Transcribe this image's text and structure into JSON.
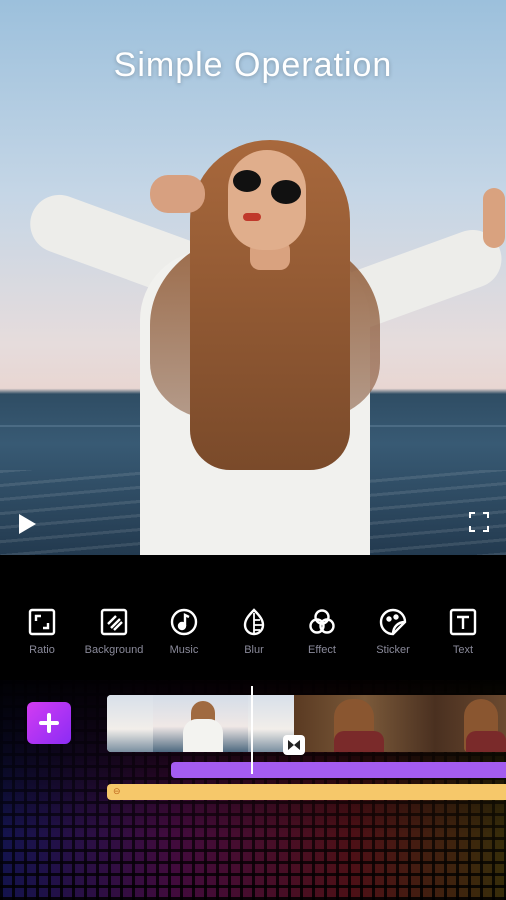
{
  "banner": {
    "title": "Simple Operation"
  },
  "preview": {
    "play_icon": "play-icon",
    "fullscreen_icon": "fullscreen-icon"
  },
  "toolbar": {
    "items": [
      {
        "label": "Ratio",
        "icon": "ratio-icon"
      },
      {
        "label": "Background",
        "icon": "background-icon"
      },
      {
        "label": "Music",
        "icon": "music-icon"
      },
      {
        "label": "Blur",
        "icon": "blur-icon"
      },
      {
        "label": "Effect",
        "icon": "effect-icon"
      },
      {
        "label": "Sticker",
        "icon": "sticker-icon"
      },
      {
        "label": "Text",
        "icon": "text-icon"
      }
    ]
  },
  "timeline": {
    "add_icon": "plus-icon",
    "transition_icon": "transition-icon",
    "colors": {
      "add_button": "#c23cf2",
      "music_track": "#a45cf0",
      "text_track": "#f6c86a",
      "label": "#8a8a9a"
    }
  }
}
